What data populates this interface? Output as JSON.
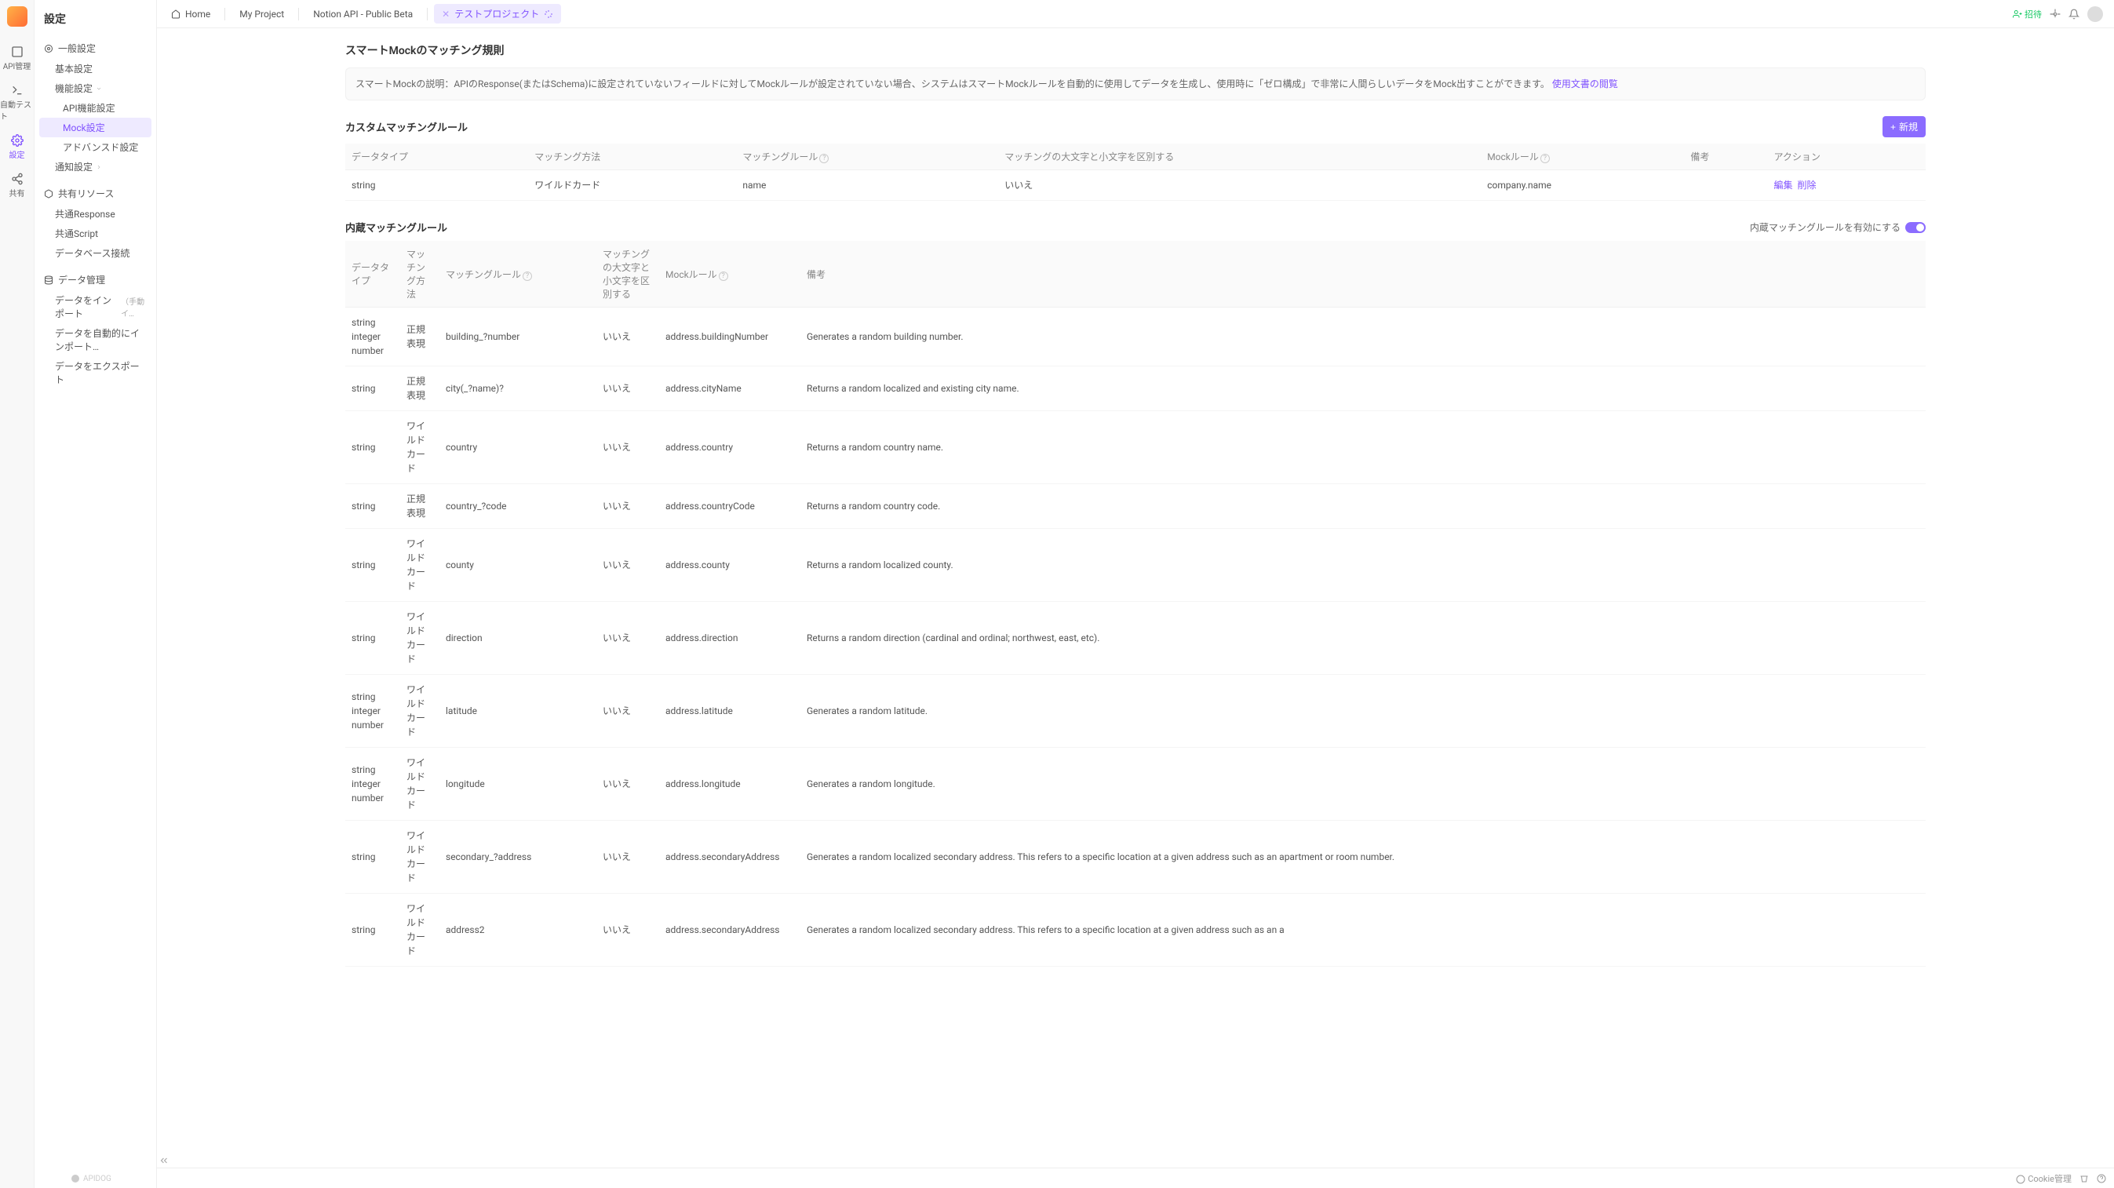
{
  "rail": {
    "items": [
      {
        "label": "API管理"
      },
      {
        "label": "自動テスト"
      },
      {
        "label": "設定"
      },
      {
        "label": "共有"
      }
    ]
  },
  "sidebar": {
    "title": "設定",
    "groups": [
      {
        "label": "一般設定",
        "items": [
          {
            "label": "基本設定"
          },
          {
            "label": "機能設定",
            "expandable": true,
            "children": [
              {
                "label": "API機能設定"
              },
              {
                "label": "Mock設定",
                "active": true
              },
              {
                "label": "アドバンスド設定"
              }
            ]
          },
          {
            "label": "通知設定",
            "expandable": true
          }
        ]
      },
      {
        "label": "共有リソース",
        "items": [
          {
            "label": "共通Response"
          },
          {
            "label": "共通Script"
          },
          {
            "label": "データベース接続"
          }
        ]
      },
      {
        "label": "データ管理",
        "items": [
          {
            "label": "データをインポート",
            "hint": "（手動イ…"
          },
          {
            "label": "データを自動的にインポート…"
          },
          {
            "label": "データをエクスポート"
          }
        ]
      }
    ]
  },
  "tabs": {
    "items": [
      {
        "label": "Home",
        "icon": "home"
      },
      {
        "label": "My Project"
      },
      {
        "label": "Notion API - Public Beta"
      },
      {
        "label": "テストプロジェクト",
        "active": true,
        "loading": true,
        "closable": true
      }
    ],
    "invite": "招待"
  },
  "page": {
    "title": "スマートMockのマッチング規則",
    "desc_prefix": "スマートMockの説明：APIのResponse(またはSchema)に設定されていないフィールドに対してMockルールが設定されていない場合、システムはスマートMockルールを自動的に使用してデータを生成し、使用時に「ゼロ構成」で非常に人間らしいデータをMock出すことができます。",
    "desc_link": "使用文書の閲覧"
  },
  "custom": {
    "title": "カスタムマッチングルール",
    "new_btn": "新規",
    "headers": [
      "データタイプ",
      "マッチング方法",
      "マッチングルール",
      "マッチングの大文字と小文字を区別する",
      "Mockルール",
      "備考",
      "アクション"
    ],
    "rows": [
      {
        "dtype": "string",
        "method": "ワイルドカード",
        "rule": "name",
        "case": "いいえ",
        "mock": "company.name",
        "note": "",
        "edit": "編集",
        "del": "削除"
      }
    ]
  },
  "builtin": {
    "title": "内蔵マッチングルール",
    "enable_label": "内蔵マッチングルールを有効にする",
    "headers": [
      "データタイプ",
      "マッチング方法",
      "マッチングルール",
      "マッチングの大文字と小文字を区別する",
      "Mockルール",
      "備考"
    ],
    "rows": [
      {
        "dtype": "string\ninteger\nnumber",
        "method": "正規表現",
        "rule": "building_?number",
        "case": "いいえ",
        "mock": "address.buildingNumber",
        "note": "Generates a random building number."
      },
      {
        "dtype": "string",
        "method": "正規表現",
        "rule": "city(_?name)?",
        "case": "いいえ",
        "mock": "address.cityName",
        "note": "Returns a random localized and existing city name."
      },
      {
        "dtype": "string",
        "method": "ワイルドカード",
        "rule": "country",
        "case": "いいえ",
        "mock": "address.country",
        "note": "Returns a random country name."
      },
      {
        "dtype": "string",
        "method": "正規表現",
        "rule": "country_?code",
        "case": "いいえ",
        "mock": "address.countryCode",
        "note": "Returns a random country code."
      },
      {
        "dtype": "string",
        "method": "ワイルドカード",
        "rule": "county",
        "case": "いいえ",
        "mock": "address.county",
        "note": "Returns a random localized county."
      },
      {
        "dtype": "string",
        "method": "ワイルドカード",
        "rule": "direction",
        "case": "いいえ",
        "mock": "address.direction",
        "note": "Returns a random direction (cardinal and ordinal; northwest, east, etc)."
      },
      {
        "dtype": "string\ninteger\nnumber",
        "method": "ワイルドカード",
        "rule": "latitude",
        "case": "いいえ",
        "mock": "address.latitude",
        "note": "Generates a random latitude."
      },
      {
        "dtype": "string\ninteger\nnumber",
        "method": "ワイルドカード",
        "rule": "longitude",
        "case": "いいえ",
        "mock": "address.longitude",
        "note": "Generates a random longitude."
      },
      {
        "dtype": "string",
        "method": "ワイルドカード",
        "rule": "secondary_?address",
        "case": "いいえ",
        "mock": "address.secondaryAddress",
        "note": "Generates a random localized secondary address. This refers to a specific location at a given address such as an apartment or room number."
      },
      {
        "dtype": "string",
        "method": "ワイルドカード",
        "rule": "address2",
        "case": "いいえ",
        "mock": "address.secondaryAddress",
        "note": "Generates a random localized secondary address. This refers to a specific location at a given address such as an a"
      }
    ]
  },
  "statusbar": {
    "brand": "APIDOG",
    "cookie": "Cookie管理"
  }
}
